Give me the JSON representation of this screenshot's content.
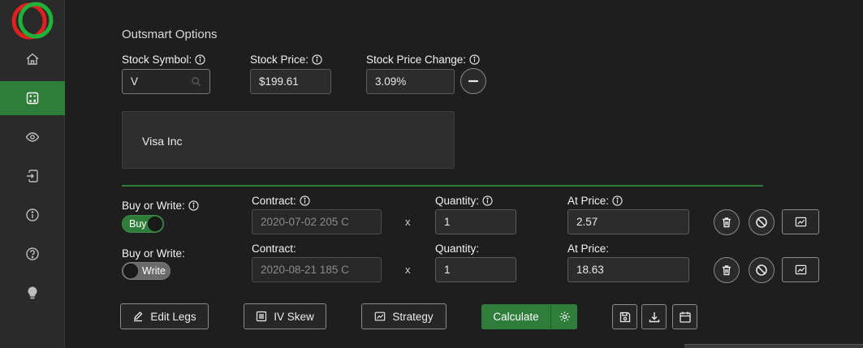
{
  "app": {
    "title": "Outsmart Options"
  },
  "sidebar": {
    "items": [
      {
        "name": "home",
        "icon": "home-icon",
        "active": false
      },
      {
        "name": "calculator",
        "icon": "calculator-icon",
        "active": true
      },
      {
        "name": "watchlist",
        "icon": "eye-icon",
        "active": false
      },
      {
        "name": "login",
        "icon": "login-icon",
        "active": false
      },
      {
        "name": "info",
        "icon": "info-icon",
        "active": false
      },
      {
        "name": "help",
        "icon": "help-icon",
        "active": false
      },
      {
        "name": "tips",
        "icon": "lightbulb-icon",
        "active": false
      }
    ]
  },
  "stock": {
    "symbol_label": "Stock Symbol:",
    "symbol_value": "V",
    "price_label": "Stock Price:",
    "price_value": "$199.61",
    "change_label": "Stock Price Change:",
    "change_value": "3.09%",
    "company_name": "Visa Inc"
  },
  "legs": [
    {
      "buy_write_label": "Buy or Write:",
      "toggle_text": "Buy",
      "toggle_on": true,
      "contract_label": "Contract:",
      "contract_value": "2020-07-02 205 C",
      "x": "x",
      "quantity_label": "Quantity:",
      "quantity_value": "1",
      "price_label": "At Price:",
      "price_value": "2.57"
    },
    {
      "buy_write_label": "Buy or Write:",
      "toggle_text": "Write",
      "toggle_on": false,
      "contract_label": "Contract:",
      "contract_value": "2020-08-21 185 C",
      "x": "x",
      "quantity_label": "Quantity:",
      "quantity_value": "1",
      "price_label": "At Price:",
      "price_value": "18.63"
    }
  ],
  "actions": {
    "edit_legs": "Edit Legs",
    "iv_skew": "IV Skew",
    "strategy": "Strategy",
    "calculate": "Calculate"
  },
  "colors": {
    "accent": "#2f7d3a",
    "background": "#1e1e1e",
    "sidebar": "#2a2a2a"
  }
}
